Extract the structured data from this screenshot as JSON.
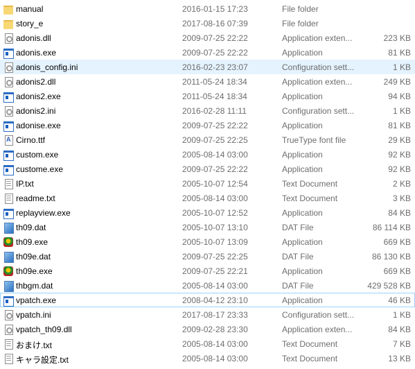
{
  "files": [
    {
      "name": "manual",
      "date": "2016-01-15 17:23",
      "type": "File folder",
      "size": "",
      "icon": "folder-icon"
    },
    {
      "name": "story_e",
      "date": "2017-08-16 07:39",
      "type": "File folder",
      "size": "",
      "icon": "folder-icon"
    },
    {
      "name": "adonis.dll",
      "date": "2009-07-25 22:22",
      "type": "Application exten...",
      "size": "223 KB",
      "icon": "dll-icon"
    },
    {
      "name": "adonis.exe",
      "date": "2009-07-25 22:22",
      "type": "Application",
      "size": "81 KB",
      "icon": "exe-icon"
    },
    {
      "name": "adonis_config.ini",
      "date": "2016-02-23 23:07",
      "type": "Configuration sett...",
      "size": "1 KB",
      "icon": "ini-icon",
      "state": "hover"
    },
    {
      "name": "adonis2.dll",
      "date": "2011-05-24 18:34",
      "type": "Application exten...",
      "size": "249 KB",
      "icon": "dll-icon"
    },
    {
      "name": "adonis2.exe",
      "date": "2011-05-24 18:34",
      "type": "Application",
      "size": "94 KB",
      "icon": "exe-icon"
    },
    {
      "name": "adonis2.ini",
      "date": "2016-02-28 11:11",
      "type": "Configuration sett...",
      "size": "1 KB",
      "icon": "ini-icon"
    },
    {
      "name": "adonise.exe",
      "date": "2009-07-25 22:22",
      "type": "Application",
      "size": "81 KB",
      "icon": "exe-icon"
    },
    {
      "name": "Cirno.ttf",
      "date": "2009-07-25 22:25",
      "type": "TrueType font file",
      "size": "29 KB",
      "icon": "font-icon"
    },
    {
      "name": "custom.exe",
      "date": "2005-08-14 03:00",
      "type": "Application",
      "size": "92 KB",
      "icon": "exe-icon"
    },
    {
      "name": "custome.exe",
      "date": "2009-07-25 22:22",
      "type": "Application",
      "size": "92 KB",
      "icon": "exe-icon"
    },
    {
      "name": "IP.txt",
      "date": "2005-10-07 12:54",
      "type": "Text Document",
      "size": "2 KB",
      "icon": "text-icon"
    },
    {
      "name": "readme.txt",
      "date": "2005-08-14 03:00",
      "type": "Text Document",
      "size": "3 KB",
      "icon": "text-icon"
    },
    {
      "name": "replayview.exe",
      "date": "2005-10-07 12:52",
      "type": "Application",
      "size": "84 KB",
      "icon": "exe-icon"
    },
    {
      "name": "th09.dat",
      "date": "2005-10-07 13:10",
      "type": "DAT File",
      "size": "86 114 KB",
      "icon": "dat-icon"
    },
    {
      "name": "th09.exe",
      "date": "2005-10-07 13:09",
      "type": "Application",
      "size": "669 KB",
      "icon": "game-icon"
    },
    {
      "name": "th09e.dat",
      "date": "2009-07-25 22:25",
      "type": "DAT File",
      "size": "86 130 KB",
      "icon": "dat-icon"
    },
    {
      "name": "th09e.exe",
      "date": "2009-07-25 22:21",
      "type": "Application",
      "size": "669 KB",
      "icon": "game-icon"
    },
    {
      "name": "thbgm.dat",
      "date": "2005-08-14 03:00",
      "type": "DAT File",
      "size": "429 528 KB",
      "icon": "dat-icon"
    },
    {
      "name": "vpatch.exe",
      "date": "2008-04-12 23:10",
      "type": "Application",
      "size": "46 KB",
      "icon": "exe-icon",
      "state": "focus"
    },
    {
      "name": "vpatch.ini",
      "date": "2017-08-17 23:33",
      "type": "Configuration sett...",
      "size": "1 KB",
      "icon": "ini-icon"
    },
    {
      "name": "vpatch_th09.dll",
      "date": "2009-02-28 23:30",
      "type": "Application exten...",
      "size": "84 KB",
      "icon": "dll-icon"
    },
    {
      "name": "おまけ.txt",
      "date": "2005-08-14 03:00",
      "type": "Text Document",
      "size": "7 KB",
      "icon": "text-icon"
    },
    {
      "name": "キャラ設定.txt",
      "date": "2005-08-14 03:00",
      "type": "Text Document",
      "size": "13 KB",
      "icon": "text-icon"
    }
  ],
  "colors": {
    "hover": "#e5f3ff",
    "focus_border": "#99d1ff",
    "secondary_text": "#6d6d6d"
  }
}
